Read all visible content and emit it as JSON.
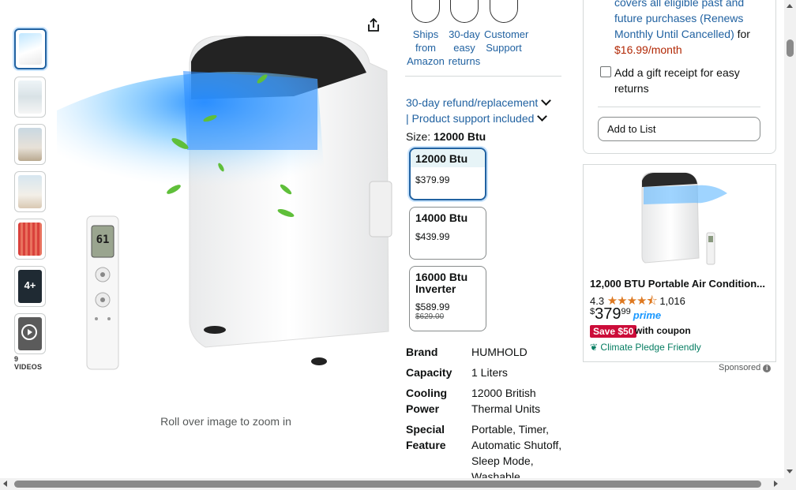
{
  "thumbnails": {
    "items": [
      "image-1",
      "image-2",
      "image-3",
      "image-4",
      "image-5",
      "image-6",
      "video"
    ],
    "more_count": "4+",
    "videos_label": "9 VIDEOS"
  },
  "zoom_hint": "Roll over image to zoom in",
  "remote_display": "61",
  "delivery_icons": [
    {
      "label": "Ships from Amazon",
      "icon": "truck-icon"
    },
    {
      "label": "30-day easy returns",
      "icon": "box-return-icon"
    },
    {
      "label": "Customer Support",
      "icon": "headset-icon"
    }
  ],
  "refund_line1": "30-day refund/replacement",
  "refund_line2": "| Product support included",
  "size": {
    "label": "Size:",
    "selected": "12000 Btu",
    "options": [
      {
        "name": "12000 Btu",
        "price": "$379.99",
        "strike": ""
      },
      {
        "name": "14000 Btu",
        "price": "$439.99",
        "strike": ""
      },
      {
        "name": "16000 Btu Inverter",
        "price": "$589.99",
        "strike": "$629.00"
      }
    ]
  },
  "specs": [
    {
      "key": "Brand",
      "value": "HUMHOLD"
    },
    {
      "key": "Capacity",
      "value": "1 Liters"
    },
    {
      "key": "Cooling Power",
      "value": "12000 British Thermal Units"
    },
    {
      "key": "Special Feature",
      "value": "Portable, Timer, Automatic Shutoff, Sleep Mode, Washable"
    }
  ],
  "buybox": {
    "sub_line1": "covers all eligible past and",
    "sub_line2": "future purchases (Renews",
    "sub_line3": "Monthly Until Cancelled)",
    "sub_for": "for",
    "sub_price": "$16.99/month",
    "gift_label": "Add a gift receipt for easy returns",
    "add_to_list": "Add to List"
  },
  "ad": {
    "title": "12,000 BTU Portable Air Condition...",
    "rating": "4.3",
    "stars": "★★★★⯪",
    "reviews": "1,016",
    "price_symbol": "$",
    "price_whole": "379",
    "price_fraction": "99",
    "prime": "prime",
    "save_badge": "Save $50",
    "coupon": "with coupon",
    "climate": "Climate Pledge Friendly",
    "sponsored": "Sponsored"
  },
  "colors": {
    "link": "#2162a1",
    "price_red": "#b12704",
    "save_red": "#cc0c39",
    "star": "#de7921",
    "prime": "#1a98ff",
    "climate_green": "#067d62"
  }
}
